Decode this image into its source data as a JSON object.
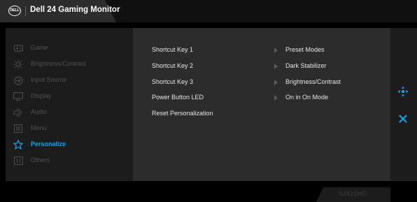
{
  "header": {
    "logo_text": "DELL",
    "title": "Dell 24 Gaming Monitor"
  },
  "menu": {
    "items": [
      {
        "label": "Game",
        "icon": "gamepad-icon",
        "active": false
      },
      {
        "label": "Brightness/Contrast",
        "icon": "brightness-icon",
        "active": false
      },
      {
        "label": "Input Source",
        "icon": "input-source-icon",
        "active": false
      },
      {
        "label": "Display",
        "icon": "display-icon",
        "active": false
      },
      {
        "label": "Audio",
        "icon": "speaker-icon",
        "active": false
      },
      {
        "label": "Menu",
        "icon": "menu-icon",
        "active": false
      },
      {
        "label": "Personalize",
        "icon": "star-icon",
        "active": true
      },
      {
        "label": "Others",
        "icon": "info-icon",
        "active": false
      }
    ]
  },
  "options": [
    {
      "label": "Shortcut Key 1",
      "value": "Preset Modes"
    },
    {
      "label": "Shortcut Key 2",
      "value": "Dark Stabilizer"
    },
    {
      "label": "Shortcut Key 3",
      "value": "Brightness/Contrast"
    },
    {
      "label": "Power Button LED",
      "value": "On in On Mode"
    },
    {
      "label": "Reset Personalization",
      "value": ""
    }
  ],
  "side_controls": {
    "nav_icon": "joystick-navigate-icon",
    "close_icon": "close-icon"
  },
  "footer": {
    "model": "S2422HG"
  },
  "colors": {
    "accent": "#1ba1e2",
    "inactive_text": "#505050",
    "text": "#e6e6e6"
  }
}
